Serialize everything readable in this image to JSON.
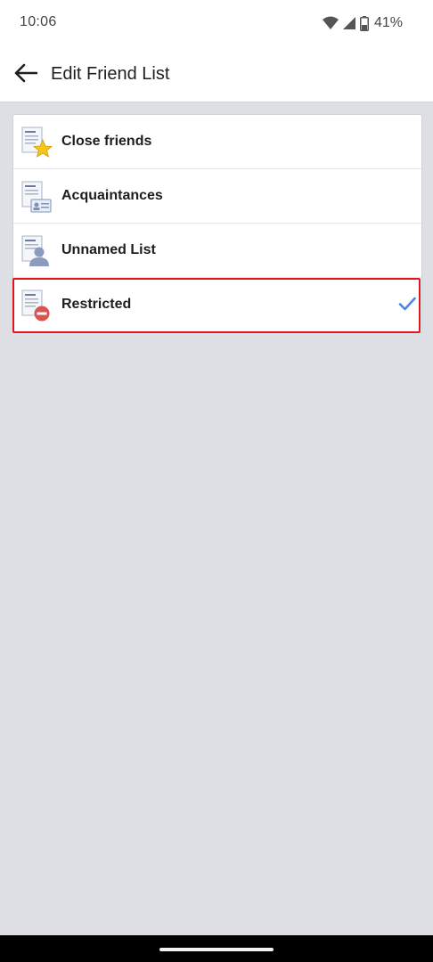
{
  "status_bar": {
    "time": "10:06",
    "battery": "41%",
    "icons": [
      "wifi-icon",
      "signal-icon",
      "battery-icon"
    ]
  },
  "app_bar": {
    "back_icon": "arrow-left-icon",
    "title": "Edit Friend List"
  },
  "lists": [
    {
      "label": "Close friends",
      "icon": "close-friends-icon",
      "selected": false
    },
    {
      "label": "Acquaintances",
      "icon": "acquaintances-icon",
      "selected": false
    },
    {
      "label": "Unnamed List",
      "icon": "unnamed-list-icon",
      "selected": false
    },
    {
      "label": "Restricted",
      "icon": "restricted-icon",
      "selected": true,
      "highlighted": true
    }
  ],
  "colors": {
    "background": "#dddfe5",
    "check": "#4a86e8",
    "highlight": "#e0141e",
    "star": "#f5c518",
    "restricted": "#d9534f"
  }
}
